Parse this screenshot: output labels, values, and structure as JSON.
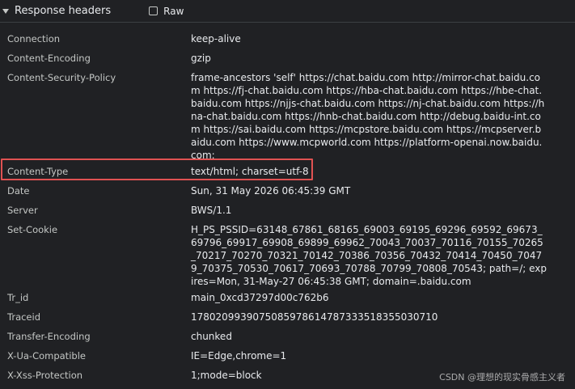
{
  "section": {
    "title": "Response headers",
    "raw_label": "Raw"
  },
  "headers": [
    {
      "name": "Connection",
      "value": "keep-alive"
    },
    {
      "name": "Content-Encoding",
      "value": "gzip"
    },
    {
      "name": "Content-Security-Policy",
      "value": "frame-ancestors 'self' https://chat.baidu.com http://mirror-chat.baidu.com https://fj-chat.baidu.com https://hba-chat.baidu.com https://hbe-chat.baidu.com https://njjs-chat.baidu.com https://nj-chat.baidu.com https://hna-chat.baidu.com https://hnb-chat.baidu.com http://debug.baidu-int.com https://sai.baidu.com https://mcpstore.baidu.com https://mcpserver.baidu.com https://www.mcpworld.com https://platform-openai.now.baidu.com;"
    },
    {
      "name": "Content-Type",
      "value": "text/html; charset=utf-8"
    },
    {
      "name": "Date",
      "value": "Sun, 31 May 2026 06:45:39 GMT"
    },
    {
      "name": "Server",
      "value": "BWS/1.1"
    },
    {
      "name": "Set-Cookie",
      "value": "H_PS_PSSID=63148_67861_68165_69003_69195_69296_69592_69673_69796_69917_69908_69899_69962_70043_70037_70116_70155_70265_70217_70270_70321_70142_70386_70356_70432_70414_70450_70479_70375_70530_70617_70693_70788_70799_70808_70543; path=/; expires=Mon, 31-May-27 06:45:38 GMT; domain=.baidu.com"
    },
    {
      "name": "Tr_id",
      "value": "main_0xcd37297d00c762b6"
    },
    {
      "name": "Traceid",
      "value": "1780209939075085978614787333518355030710"
    },
    {
      "name": "Transfer-Encoding",
      "value": "chunked"
    },
    {
      "name": "X-Ua-Compatible",
      "value": "IE=Edge,chrome=1"
    },
    {
      "name": "X-Xss-Protection",
      "value": "1;mode=block"
    }
  ],
  "watermark": "CSDN @理想的现实骨感主义者"
}
